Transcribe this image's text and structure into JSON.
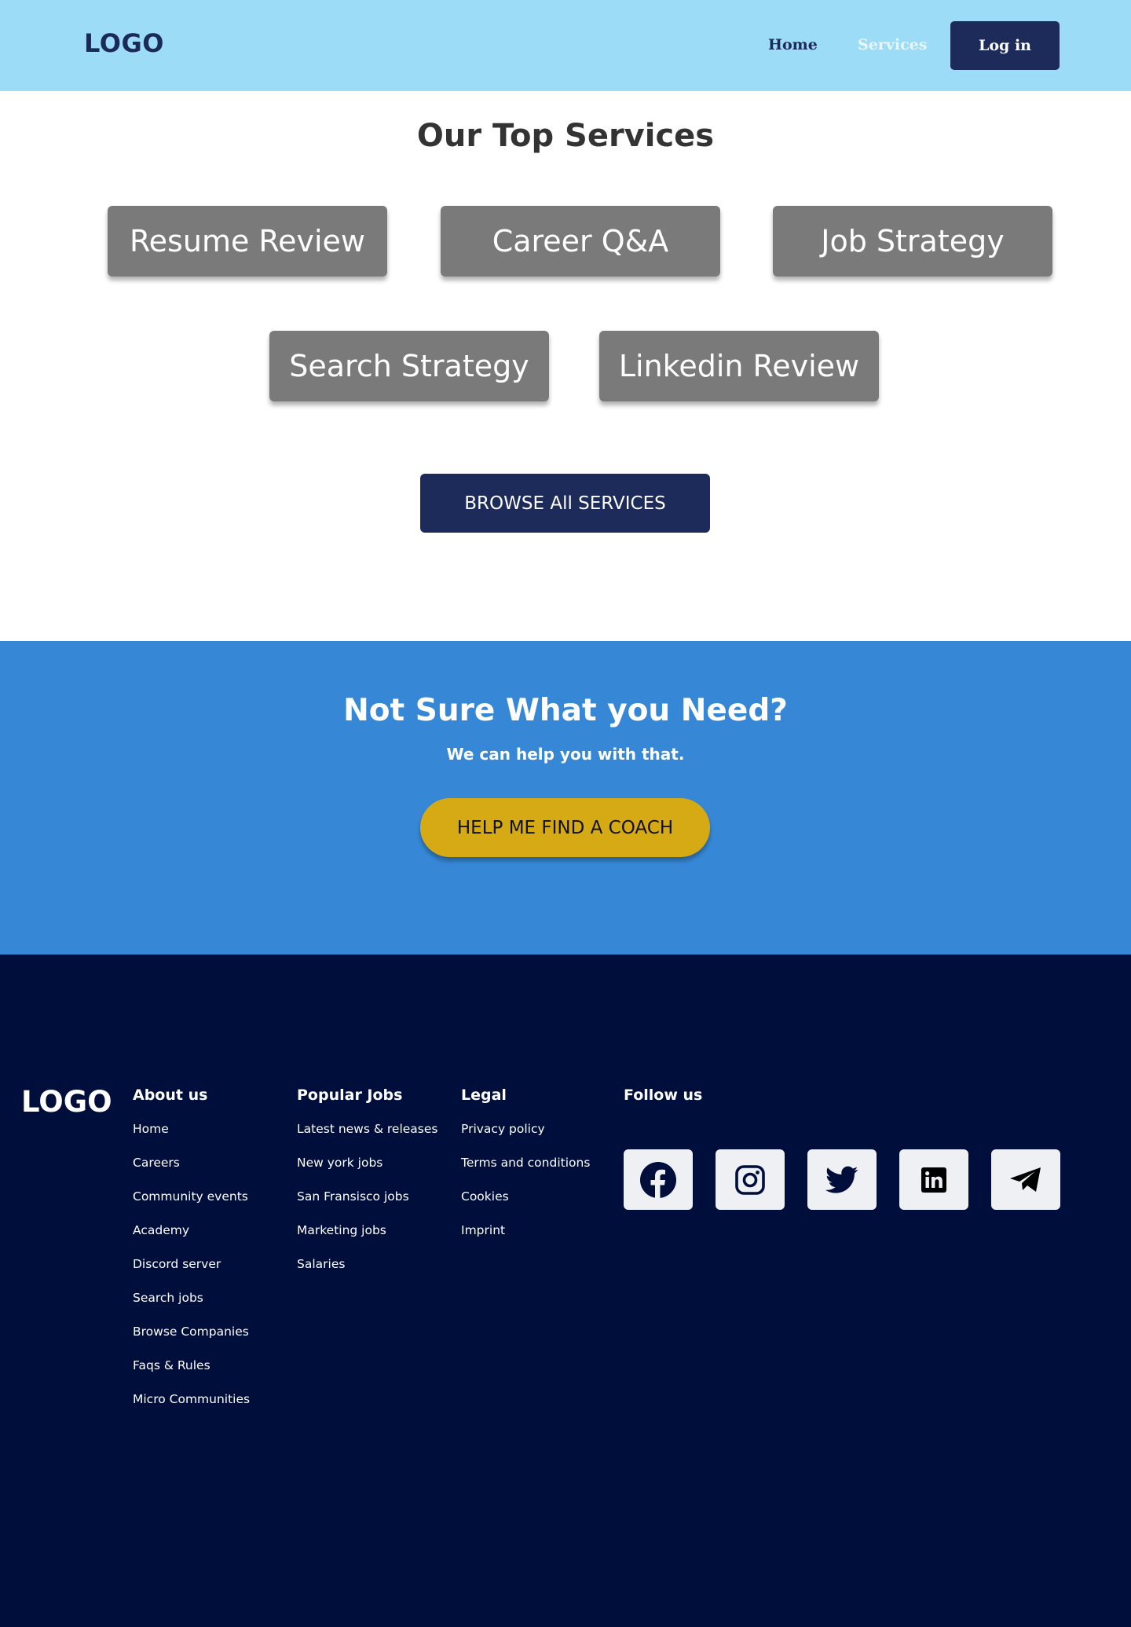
{
  "header": {
    "logo": "LOGO",
    "nav": {
      "home": "Home",
      "services": "Services"
    },
    "login_label": "Log in"
  },
  "services": {
    "title": "Our Top Services",
    "items": [
      "Resume Review",
      "Career Q&A",
      "Job Strategy",
      "Search Strategy",
      "Linkedin Review"
    ],
    "browse_label": "BROWSE All SERVICES"
  },
  "cta": {
    "title": "Not Sure What you Need?",
    "subtitle": "We can help you with that.",
    "button_label": "HELP ME FIND A COACH"
  },
  "footer": {
    "logo": "LOGO",
    "about": {
      "heading": "About us",
      "links": [
        "Home",
        "Careers",
        "Community events",
        "Academy",
        "Discord server",
        "Search jobs",
        "Browse Companies",
        "Faqs & Rules",
        "Micro Communities"
      ]
    },
    "jobs": {
      "heading": "Popular Jobs",
      "links": [
        "Latest news & releases",
        "New york jobs",
        "San Fransisco jobs",
        "Marketing jobs",
        "Salaries"
      ]
    },
    "legal": {
      "heading": "Legal",
      "links": [
        "Privacy policy",
        "Terms and conditions",
        "Cookies",
        "Imprint"
      ]
    },
    "follow": {
      "heading": "Follow us",
      "icons": [
        "facebook-icon",
        "instagram-icon",
        "twitter-icon",
        "linkedin-icon",
        "telegram-icon"
      ]
    }
  },
  "colors": {
    "header_bg": "#9cdcf6",
    "navy": "#1d2b5b",
    "card_gray": "#7a7a7a",
    "cta_bg": "#3688d7",
    "coach_button": "#d6aa14",
    "footer_bg": "#000e3c",
    "social_tile": "#eef0f4"
  }
}
